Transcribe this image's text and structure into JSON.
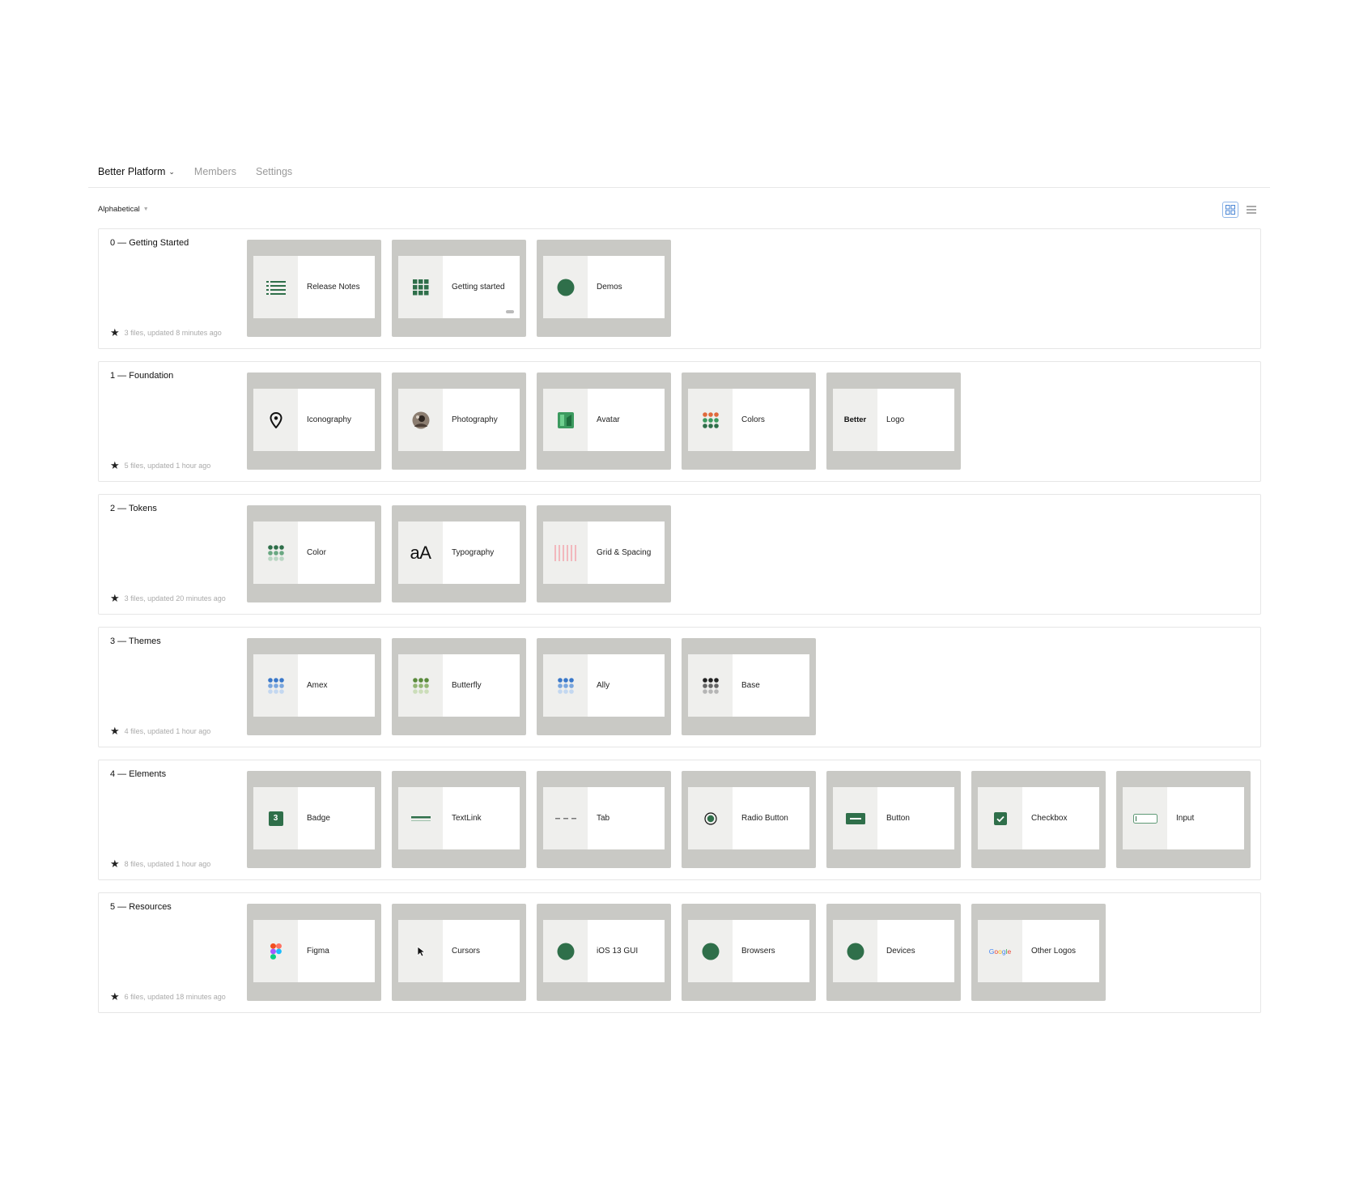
{
  "nav": {
    "team_name": "Better Platform",
    "members": "Members",
    "settings": "Settings"
  },
  "sort_label": "Alphabetical",
  "view_toggle": {
    "grid_icon": "grid-view-icon",
    "list_icon": "list-view-icon",
    "active": "grid"
  },
  "colors": {
    "accent_green": "#2f6f4a",
    "card_frame": "#c9c9c5",
    "thumb_bg": "#efefed"
  },
  "projects": [
    {
      "title": "0 — Getting Started",
      "meta": "3 files, updated 8 minutes ago",
      "files": [
        {
          "name": "Release Notes",
          "icon": "list-icon"
        },
        {
          "name": "Getting started",
          "icon": "grid-dots-icon"
        },
        {
          "name": "Demos",
          "icon": "green-circle-icon"
        }
      ]
    },
    {
      "title": "1 — Foundation",
      "meta": "5 files, updated 1 hour ago",
      "files": [
        {
          "name": "Iconography",
          "icon": "location-pin-icon"
        },
        {
          "name": "Photography",
          "icon": "photo-avatar-icon"
        },
        {
          "name": "Avatar",
          "icon": "avatar-logo-icon"
        },
        {
          "name": "Colors",
          "icon": "color-dots-icon"
        },
        {
          "name": "Logo",
          "icon": "better-wordmark-icon",
          "thumb_text": "Better"
        }
      ]
    },
    {
      "title": "2 — Tokens",
      "meta": "3 files, updated 20 minutes ago",
      "files": [
        {
          "name": "Color",
          "icon": "green-dots-icon"
        },
        {
          "name": "Typography",
          "icon": "typography-icon",
          "thumb_text": "aA"
        },
        {
          "name": "Grid & Spacing",
          "icon": "grid-columns-icon"
        }
      ]
    },
    {
      "title": "3 — Themes",
      "meta": "4 files, updated 1 hour ago",
      "files": [
        {
          "name": "Amex",
          "icon": "blue-dots-icon"
        },
        {
          "name": "Butterfly",
          "icon": "olive-dots-icon"
        },
        {
          "name": "Ally",
          "icon": "blue-dots-icon"
        },
        {
          "name": "Base",
          "icon": "dark-dots-icon"
        }
      ]
    },
    {
      "title": "4 — Elements",
      "meta": "8 files, updated 1 hour ago",
      "files": [
        {
          "name": "Badge",
          "icon": "badge-icon",
          "thumb_text": "3"
        },
        {
          "name": "TextLink",
          "icon": "textlink-icon"
        },
        {
          "name": "Tab",
          "icon": "tab-icon"
        },
        {
          "name": "Radio Button",
          "icon": "radio-icon"
        },
        {
          "name": "Button",
          "icon": "button-icon"
        },
        {
          "name": "Checkbox",
          "icon": "checkbox-icon"
        },
        {
          "name": "Input",
          "icon": "input-icon"
        }
      ]
    },
    {
      "title": "5 — Resources",
      "meta": "6 files, updated 18 minutes ago",
      "files": [
        {
          "name": "Figma",
          "icon": "figma-icon"
        },
        {
          "name": "Cursors",
          "icon": "cursor-icon"
        },
        {
          "name": "iOS 13 GUI",
          "icon": "green-circle-icon"
        },
        {
          "name": "Browsers",
          "icon": "green-circle-icon"
        },
        {
          "name": "Devices",
          "icon": "green-circle-icon"
        },
        {
          "name": "Other Logos",
          "icon": "google-logo-icon",
          "thumb_text": "Google"
        }
      ]
    }
  ]
}
